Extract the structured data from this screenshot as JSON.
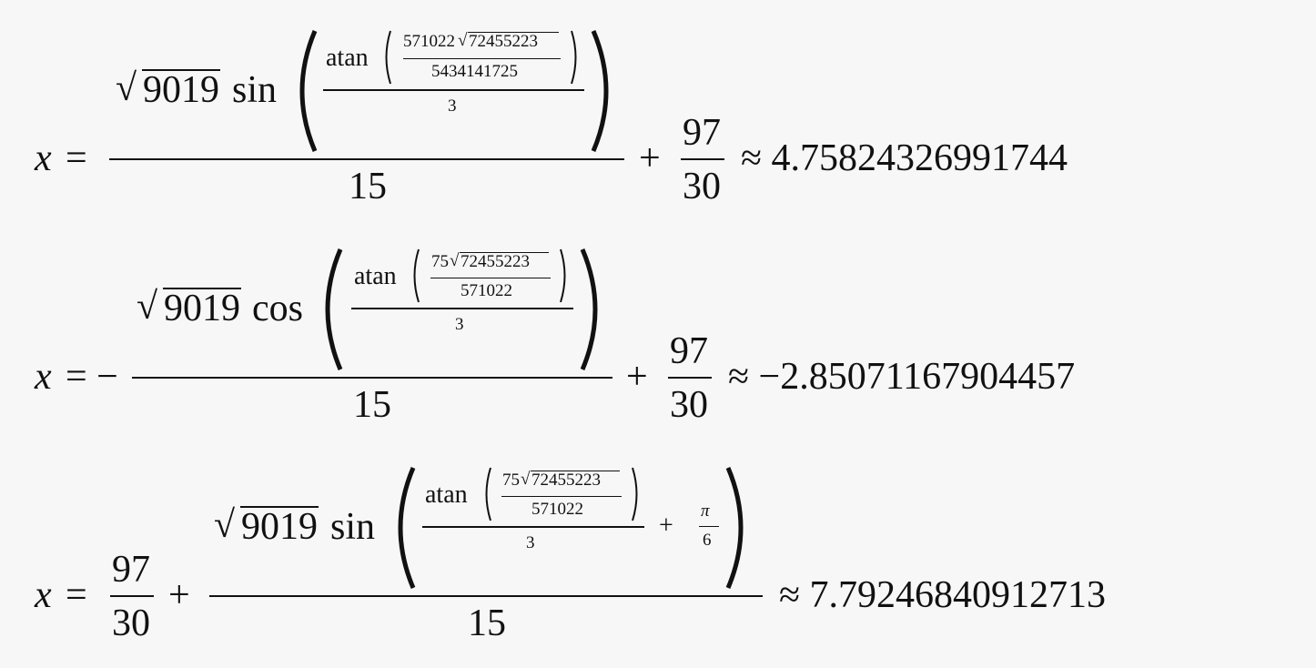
{
  "equations": [
    {
      "lhs": "x",
      "eq": "=",
      "sqrt_arg": "9019",
      "func": "sin",
      "atan": "atan",
      "inner_num_coef": "571022",
      "inner_sqrt": "72455223",
      "inner_den": "5434141725",
      "div3": "3",
      "outer_den": "15",
      "plus": "+",
      "frac_num": "97",
      "frac_den": "30",
      "approx": "≈ 4.75824326991744"
    },
    {
      "lhs": "x",
      "eq": "= −",
      "sqrt_arg": "9019",
      "func": "cos",
      "atan": "atan",
      "inner_num_coef": "75",
      "inner_sqrt": "72455223",
      "inner_den": "571022",
      "div3": "3",
      "outer_den": "15",
      "plus": "+",
      "frac_num": "97",
      "frac_den": "30",
      "approx": "≈ −2.85071167904457"
    },
    {
      "lhs": "x",
      "eq": "=",
      "frac_num": "97",
      "frac_den": "30",
      "plus": "+",
      "sqrt_arg": "9019",
      "func": "sin",
      "atan": "atan",
      "inner_num_coef": "75",
      "inner_sqrt": "72455223",
      "inner_den": "571022",
      "div3": "3",
      "plus2": "+",
      "pi": "π",
      "six": "6",
      "outer_den": "15",
      "approx": "≈ 7.79246840912713"
    }
  ]
}
